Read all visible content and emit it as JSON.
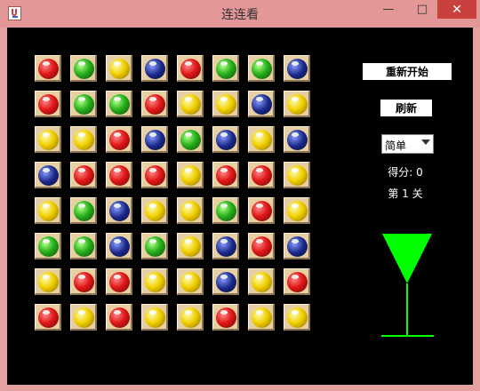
{
  "window": {
    "title": "连连看",
    "minimize_glyph": "—",
    "maximize_glyph": "□",
    "close_glyph": "✕"
  },
  "board": {
    "rows": [
      [
        "red",
        "green",
        "yellow",
        "blue",
        "red",
        "green",
        "green",
        "blue"
      ],
      [
        "red",
        "green",
        "green",
        "red",
        "yellow",
        "yellow",
        "blue",
        "yellow"
      ],
      [
        "yellow",
        "yellow",
        "red",
        "blue",
        "green",
        "blue",
        "yellow",
        "blue"
      ],
      [
        "blue",
        "red",
        "red",
        "red",
        "yellow",
        "red",
        "red",
        "yellow"
      ],
      [
        "yellow",
        "green",
        "blue",
        "yellow",
        "yellow",
        "green",
        "red",
        "yellow"
      ],
      [
        "green",
        "green",
        "blue",
        "green",
        "yellow",
        "blue",
        "red",
        "blue"
      ],
      [
        "yellow",
        "red",
        "red",
        "yellow",
        "yellow",
        "blue",
        "yellow",
        "red"
      ],
      [
        "red",
        "yellow",
        "red",
        "yellow",
        "yellow",
        "red",
        "yellow",
        "yellow"
      ]
    ]
  },
  "panel": {
    "restart_label": "重新开始",
    "refresh_label": "刷新",
    "difficulty_value": "简单",
    "score_label": "得分: 0",
    "level_label": "第 1 关"
  },
  "colors": {
    "red": "#e01818",
    "green": "#28b01c",
    "yellow": "#f0d000",
    "blue": "#1c2a8a",
    "timer": "#00ff00"
  }
}
